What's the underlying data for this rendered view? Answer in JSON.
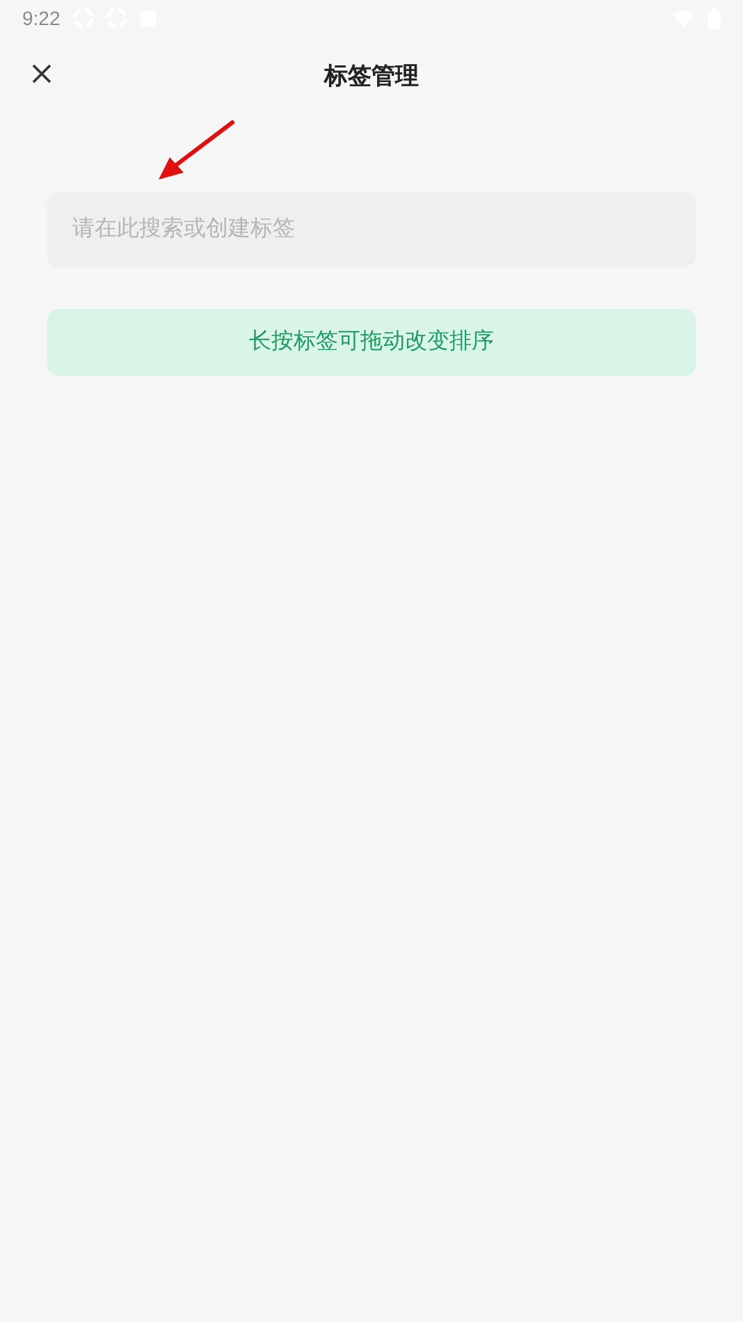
{
  "status_bar": {
    "time": "9:22"
  },
  "header": {
    "title": "标签管理"
  },
  "search": {
    "placeholder": "请在此搜索或创建标签"
  },
  "hint": {
    "text": "长按标签可拖动改变排序"
  }
}
